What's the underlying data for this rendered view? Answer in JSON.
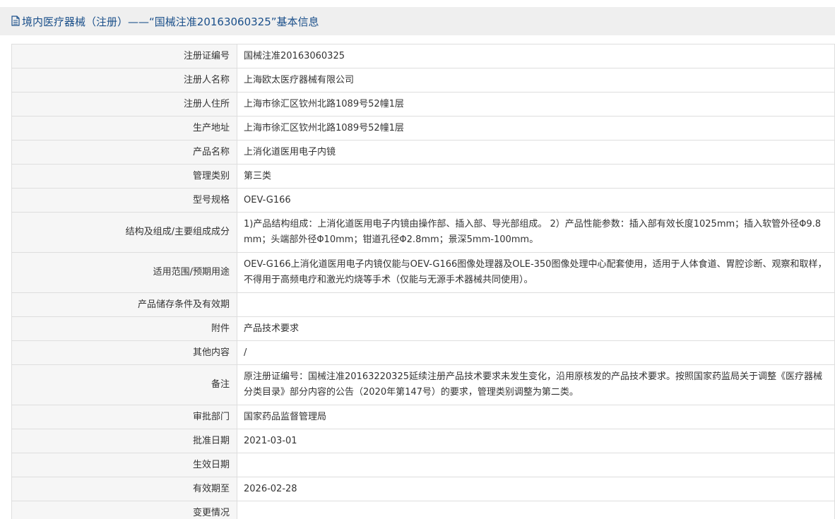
{
  "header": {
    "icon": "document-icon",
    "title": "境内医疗器械（注册）——“国械注准20163060325”基本信息"
  },
  "rows": [
    {
      "label": "注册证编号",
      "value": "国械注准20163060325"
    },
    {
      "label": "注册人名称",
      "value": "上海欧太医疗器械有限公司"
    },
    {
      "label": "注册人住所",
      "value": "上海市徐汇区钦州北路1089号52幢1层"
    },
    {
      "label": "生产地址",
      "value": "上海市徐汇区钦州北路1089号52幢1层"
    },
    {
      "label": "产品名称",
      "value": "上消化道医用电子内镜"
    },
    {
      "label": "管理类别",
      "value": "第三类"
    },
    {
      "label": "型号规格",
      "value": "OEV-G166"
    },
    {
      "label": "结构及组成/主要组成成分",
      "value": "1)产品结构组成：上消化道医用电子内镜由操作部、插入部、导光部组成。 2）产品性能参数：插入部有效长度1025mm；插入软管外径Φ9.8 mm；头端部外径Φ10mm；钳道孔径Φ2.8mm；景深5mm-100mm。"
    },
    {
      "label": "适用范围/预期用途",
      "value": "OEV-G166上消化道医用电子内镜仅能与OEV-G166图像处理器及OLE-350图像处理中心配套使用，适用于人体食道、胃腔诊断、观察和取样，不得用于高频电疗和激光灼烧等手术（仅能与无源手术器械共同使用）。"
    },
    {
      "label": "产品储存条件及有效期",
      "value": ""
    },
    {
      "label": "附件",
      "value": "产品技术要求"
    },
    {
      "label": "其他内容",
      "value": "/"
    },
    {
      "label": "备注",
      "value": "原注册证编号：国械注准20163220325延续注册产品技术要求未发生变化，沿用原核发的产品技术要求。按照国家药监局关于调整《医疗器械分类目录》部分内容的公告（2020年第147号）的要求，管理类别调整为第二类。"
    },
    {
      "label": "审批部门",
      "value": "国家药品监督管理局"
    },
    {
      "label": "批准日期",
      "value": "2021-03-01"
    },
    {
      "label": "生效日期",
      "value": ""
    },
    {
      "label": "有效期至",
      "value": "2026-02-28"
    },
    {
      "label": "变更情况",
      "value": ""
    }
  ],
  "colors": {
    "header_bg": "#efefef",
    "title_color": "#1a4f8a",
    "label_bg": "#f6f6f6",
    "border": "#dedede",
    "text": "#333333"
  }
}
